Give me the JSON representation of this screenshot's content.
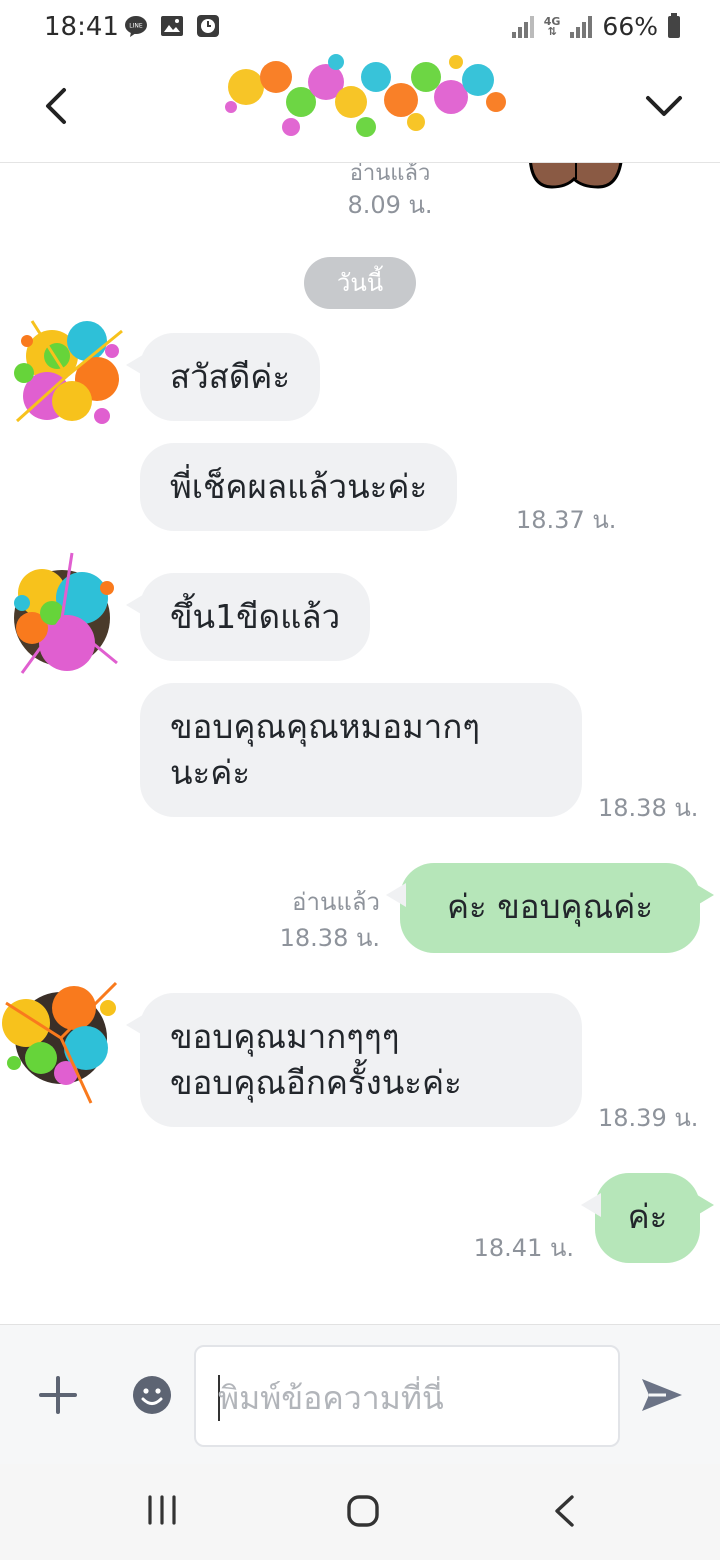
{
  "status_bar": {
    "time": "18:41",
    "network": "4G",
    "battery": "66%",
    "left_icons": [
      "line-icon",
      "image-icon",
      "clock-icon"
    ]
  },
  "header": {
    "title": "",
    "back_icon": "chevron-left-icon",
    "menu_icon": "chevron-down-icon"
  },
  "chat": {
    "top_read": "อ่านแล้ว",
    "top_time": "8.09 น.",
    "date_divider": "วันนี้",
    "messages": [
      {
        "from": "them",
        "text": "สวัสดีค่ะ"
      },
      {
        "from": "them",
        "text": "พี่เช็คผลแล้วนะค่ะ",
        "time": "18.37 น."
      },
      {
        "from": "them",
        "text": "ขึ้น1ขีดแล้ว"
      },
      {
        "from": "them",
        "lines": [
          "ขอบคุณคุณหมอมากๆ",
          "นะค่ะ"
        ],
        "time": "18.38 น."
      },
      {
        "from": "me",
        "text": "ค่ะ ขอบคุณค่ะ",
        "read": "อ่านแล้ว",
        "time": "18.38 น."
      },
      {
        "from": "them",
        "lines": [
          "ขอบคุณมากๆๆๆ",
          "ขอบคุณอีกครั้งนะค่ะ"
        ],
        "time": "18.39 น."
      },
      {
        "from": "me",
        "text": "ค่ะ",
        "time": "18.41 น."
      }
    ]
  },
  "input": {
    "placeholder": "พิมพ์ข้อความที่นี่",
    "value": ""
  },
  "colors": {
    "my_bubble": "#b6e6b9",
    "their_bubble": "#f0f1f3",
    "meta_text": "#8e939b",
    "send_icon": "#6b7386"
  }
}
